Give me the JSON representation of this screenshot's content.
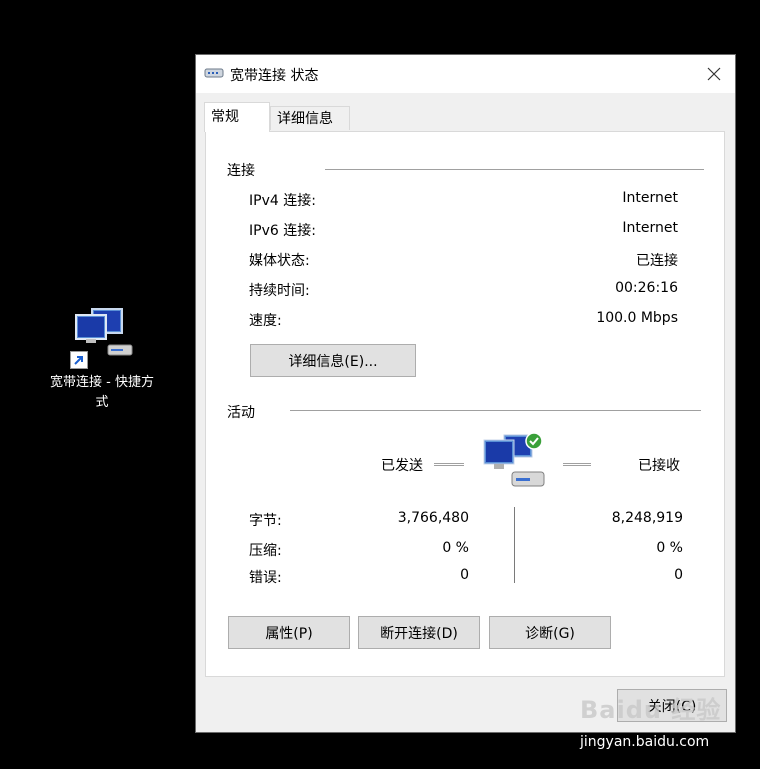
{
  "desktop": {
    "shortcut_label": "宽带连接 - 快捷方式"
  },
  "window": {
    "title": "宽带连接 状态",
    "tabs": [
      {
        "label": "常规"
      },
      {
        "label": "详细信息"
      }
    ],
    "connection": {
      "section_title": "连接",
      "rows": [
        {
          "label": "IPv4 连接:",
          "value": "Internet"
        },
        {
          "label": "IPv6 连接:",
          "value": "Internet"
        },
        {
          "label": "媒体状态:",
          "value": "已连接"
        },
        {
          "label": "持续时间:",
          "value": "00:26:16"
        },
        {
          "label": "速度:",
          "value": "100.0 Mbps"
        }
      ],
      "details_button": "详细信息(E)..."
    },
    "activity": {
      "section_title": "活动",
      "sent_label": "已发送",
      "received_label": "已接收",
      "rows": [
        {
          "label": "字节:",
          "sent": "3,766,480",
          "received": "8,248,919"
        },
        {
          "label": "压缩:",
          "sent": "0 %",
          "received": "0 %"
        },
        {
          "label": "错误:",
          "sent": "0",
          "received": "0"
        }
      ]
    },
    "buttons": {
      "properties": "属性(P)",
      "disconnect": "断开连接(D)",
      "diagnose": "诊断(G)",
      "close": "关闭(C)"
    }
  },
  "watermark": {
    "logo": "Baidu 经验",
    "url": "jingyan.baidu.com"
  },
  "colors": {
    "desktop_bg": "#000000",
    "window_bg": "#f0f0f0",
    "panel_bg": "#ffffff",
    "button_bg": "#e1e1e1",
    "status_ok": "#3aa03a"
  }
}
